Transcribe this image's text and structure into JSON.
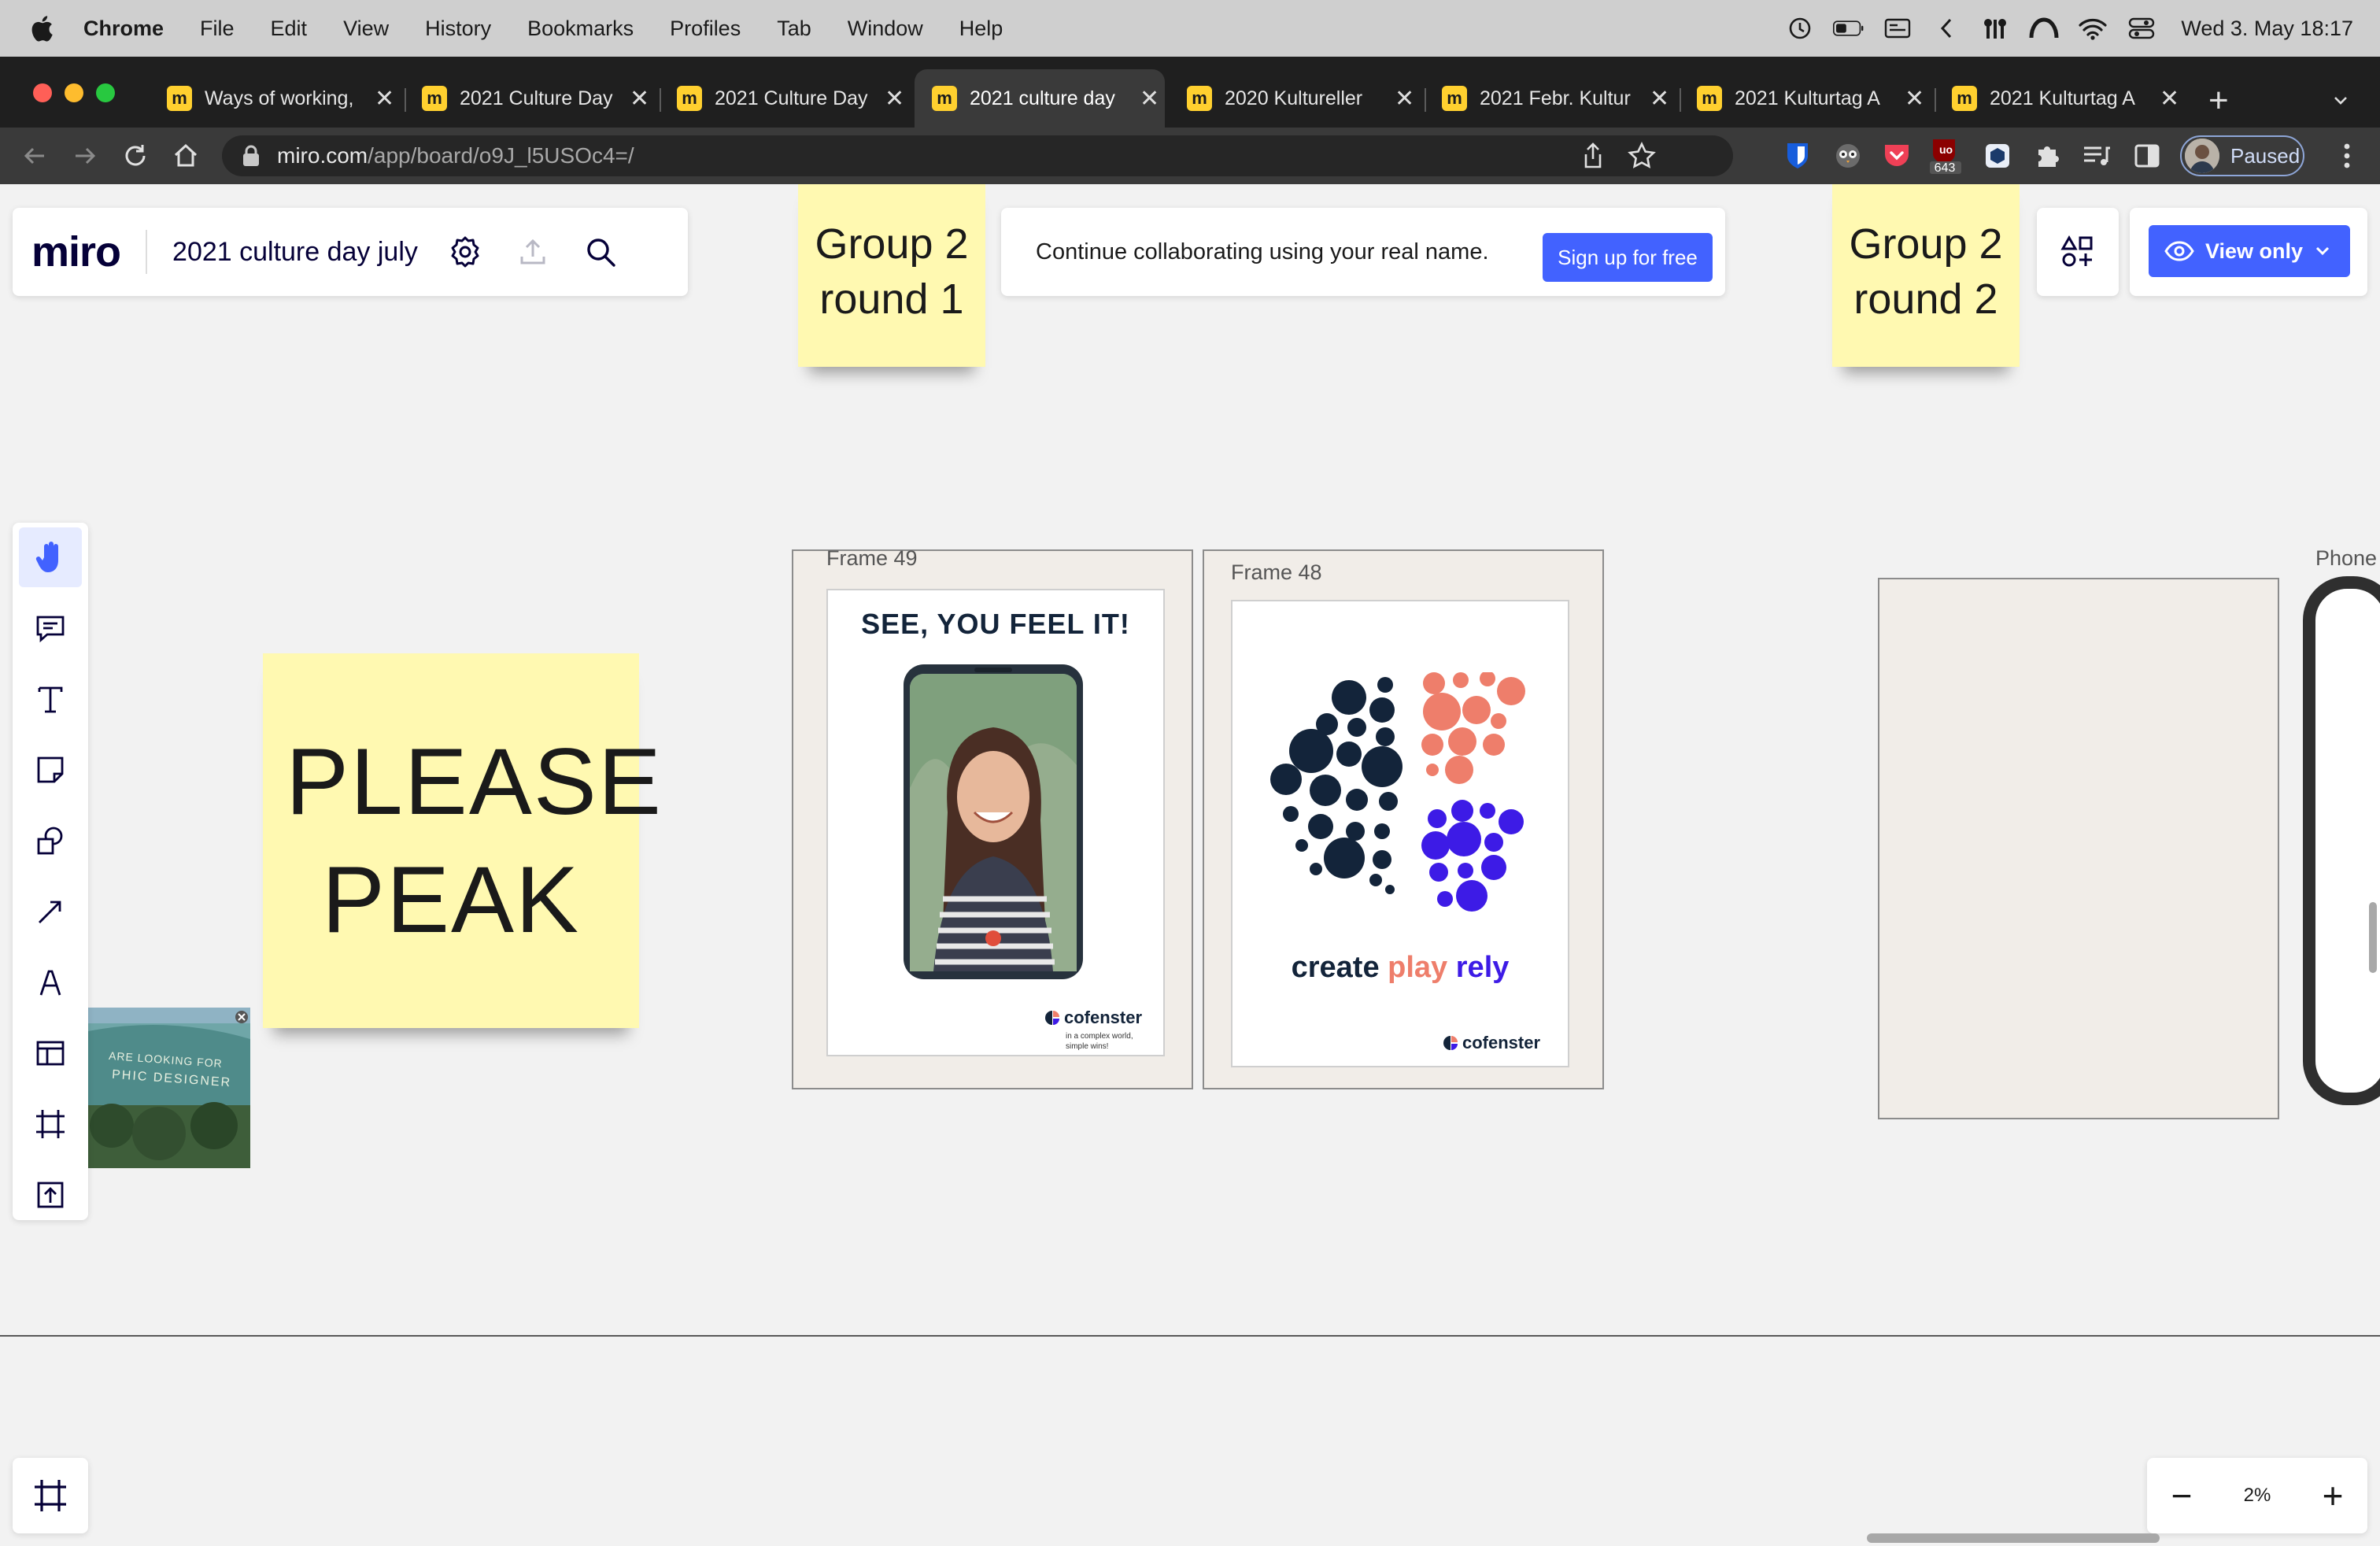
{
  "menubar": {
    "app_name": "Chrome",
    "items": [
      "File",
      "Edit",
      "View",
      "History",
      "Bookmarks",
      "Profiles",
      "Tab",
      "Window",
      "Help"
    ],
    "clock": "Wed 3. May  18:17"
  },
  "tabs": [
    {
      "title": "Ways of working,",
      "active": false
    },
    {
      "title": "2021 Culture Day",
      "active": false
    },
    {
      "title": "2021 Culture Day",
      "active": false
    },
    {
      "title": "2021 culture day",
      "active": true
    },
    {
      "title": "2020 Kultureller",
      "active": false
    },
    {
      "title": "2021 Febr. Kultur",
      "active": false
    },
    {
      "title": "2021 Kulturtag A",
      "active": false
    },
    {
      "title": "2021 Kulturtag A",
      "active": false
    }
  ],
  "toolbar": {
    "url_host": "miro.com",
    "url_path": "/app/board/o9J_l5USOc4=/",
    "extension_badge": "643",
    "profile_label": "Paused"
  },
  "board": {
    "logo": "miro",
    "name": "2021 culture day july",
    "signup_message": "Continue collaborating using your real name.",
    "signup_button": "Sign up for free",
    "view_only_label": "View only",
    "zoom_level": "2%",
    "sticky_group2_round1": "Group 2 round 1",
    "sticky_group2_round2": "Group 2 round 2",
    "sticky_please_peak": "PLEASE PEAK",
    "frame_49_label": "Frame 49",
    "frame_48_label": "Frame 48",
    "phone_label": "Phone",
    "poster1_headline": "SEE, YOU FEEL IT!",
    "poster_brand": "cofenster",
    "poster1_tagline_1": "in a complex world,",
    "poster1_tagline_2": "simple wins!",
    "poster2_word1": "create",
    "poster2_word2": "play",
    "poster2_word3": "rely",
    "image_sign_line1": "ARE LOOKING FOR",
    "image_sign_line2": "PHIC  DESIGNER"
  },
  "colors": {
    "miro_blue": "#4262ff",
    "sticky_yellow": "#fff9b1",
    "dots_dark": "#13243a",
    "dots_coral": "#ee7e6b",
    "dots_violet": "#3d1be6"
  }
}
